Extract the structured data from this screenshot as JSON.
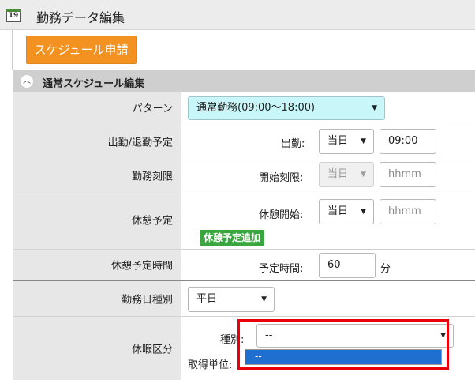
{
  "header": {
    "title": "勤務データ編集",
    "icon_text": "19"
  },
  "schedule_button": "スケジュール申請",
  "section": {
    "title": "通常スケジュール編集"
  },
  "rows": {
    "pattern": {
      "label": "パターン",
      "select_value": "通常勤務(09:00～18:00)"
    },
    "attendance": {
      "label": "出勤/退勤予定",
      "sub_label": "出勤:",
      "day_value": "当日",
      "time_value": "09:00"
    },
    "limit": {
      "label": "勤務刻限",
      "sub_label": "開始刻限:",
      "day_value": "当日",
      "time_placeholder": "hhmm"
    },
    "break": {
      "label": "休憩予定",
      "sub_label": "休憩開始:",
      "day_value": "当日",
      "time_placeholder": "hhmm",
      "add_button": "休憩予定追加"
    },
    "break_time": {
      "label": "休憩予定時間",
      "sub_label": "予定時間:",
      "value": "60",
      "unit": "分"
    },
    "day_type": {
      "label": "勤務日種別",
      "select_value": "平日"
    },
    "leave": {
      "label": "休暇区分",
      "kind_label": "種別:",
      "kind_value": "--",
      "unit_label": "取得単位:",
      "dropdown_option": "--"
    }
  },
  "colors": {
    "accent_orange": "#f39220",
    "pattern_select_bg": "#c9f6f9",
    "green_button": "#3aa640",
    "highlight_red": "#e8000b",
    "selected_option": "#1f6fd1"
  },
  "icons": [
    "calendar-icon",
    "collapse-up-icon",
    "caret-down-icon"
  ]
}
